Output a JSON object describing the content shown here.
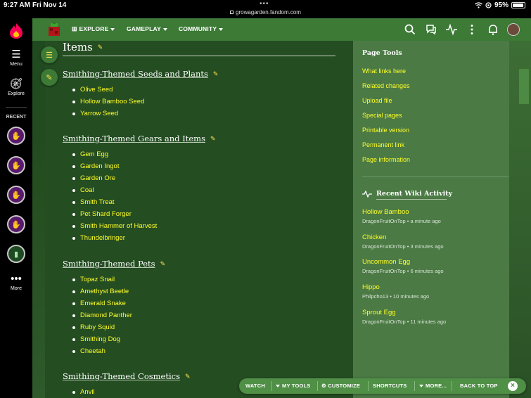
{
  "status_bar": {
    "time": "9:27 AM",
    "date": "Fri Nov 14",
    "url": "growagarden.fandom.com",
    "battery": "95%",
    "battery_level": 0.95
  },
  "left_rail": {
    "menu_label": "Menu",
    "explore_label": "Explore",
    "recent_label": "RECENT",
    "more_label": "More"
  },
  "nav": {
    "explore": "EXPLORE",
    "gameplay": "GAMEPLAY",
    "community": "COMMUNITY"
  },
  "article": {
    "title": "Items",
    "sections": [
      {
        "heading": "Smithing-Themed Seeds and Plants",
        "items": [
          "Olive Seed",
          "Hollow Bamboo Seed",
          "Yarrow Seed"
        ]
      },
      {
        "heading": "Smithing-Themed Gears and Items",
        "items": [
          "Gem Egg",
          "Garden Ingot",
          "Garden Ore",
          "Coal",
          "Smith Treat",
          "Pet Shard Forger",
          "Smith Hammer of Harvest",
          "Thundelbringer"
        ]
      },
      {
        "heading": "Smithing-Themed Pets",
        "items": [
          "Topaz Snail",
          "Amethyst Beetle",
          "Emerald Snake",
          "Diamond Panther",
          "Ruby Squid",
          "Smithing Dog",
          "Cheetah"
        ]
      },
      {
        "heading": "Smithing-Themed Cosmetics",
        "items": [
          "Anvil"
        ]
      }
    ]
  },
  "page_tools": {
    "title": "Page Tools",
    "links": [
      "What links here",
      "Related changes",
      "Upload file",
      "Special pages",
      "Printable version",
      "Permanent link",
      "Page information"
    ]
  },
  "recent_activity": {
    "title": "Recent Wiki Activity",
    "items": [
      {
        "name": "Hollow Bamboo",
        "meta": "DragonFruitOnTop • a minute ago"
      },
      {
        "name": "Chicken",
        "meta": "DragonFruitOnTop • 3 minutes ago"
      },
      {
        "name": "Uncommon Egg",
        "meta": "DragonFruitOnTop • 6 minutes ago"
      },
      {
        "name": "Hippo",
        "meta": "Philpcho13 • 10 minutes ago"
      },
      {
        "name": "Sprout Egg",
        "meta": "DragonFruitOnTop • 11 minutes ago"
      }
    ]
  },
  "toolbar": {
    "watch": "WATCH",
    "my_tools": "MY TOOLS",
    "customize": "CUSTOMIZE",
    "shortcuts": "SHORTCUTS",
    "more": "MORE...",
    "back_to_top": "BACK TO TOP"
  },
  "colors": {
    "nav_green": "#3c7a36",
    "article_bg": "#244d22",
    "rail_bg": "#4b7a45",
    "link_yellow": "#ffff27"
  }
}
